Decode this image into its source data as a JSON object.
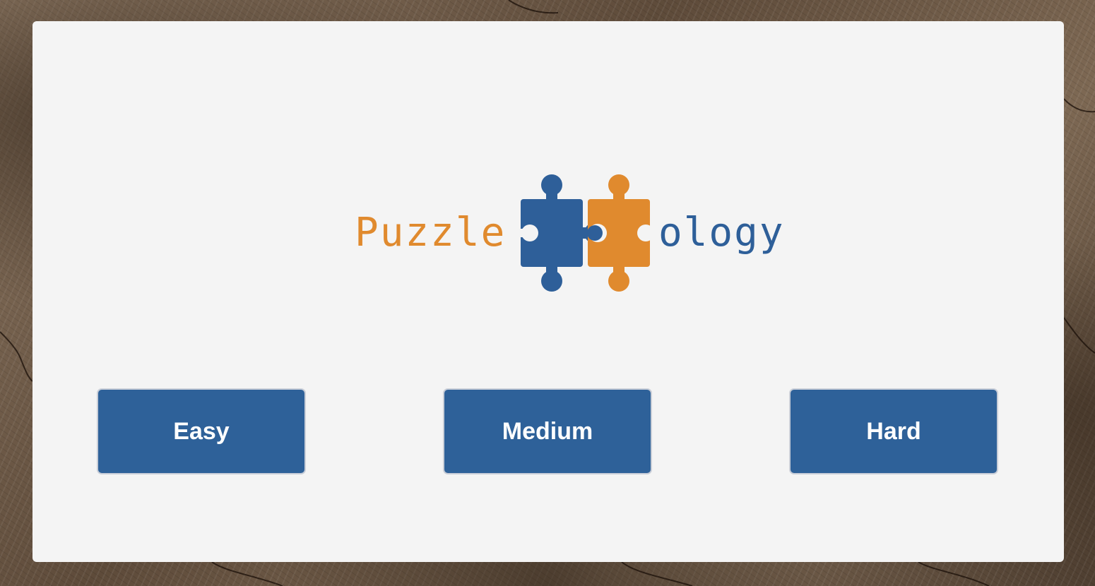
{
  "logo": {
    "left_word": "Puzzle",
    "right_word": "ology",
    "icon": "jigsaw-pieces-icon",
    "colors": {
      "orange": "#e08a2e",
      "blue": "#2e5f99"
    }
  },
  "difficulty": {
    "easy_label": "Easy",
    "medium_label": "Medium",
    "hard_label": "Hard"
  },
  "colors": {
    "button_bg": "#2e6199",
    "button_text": "#ffffff",
    "panel_bg": "#f4f4f4",
    "background": "wood texture"
  }
}
